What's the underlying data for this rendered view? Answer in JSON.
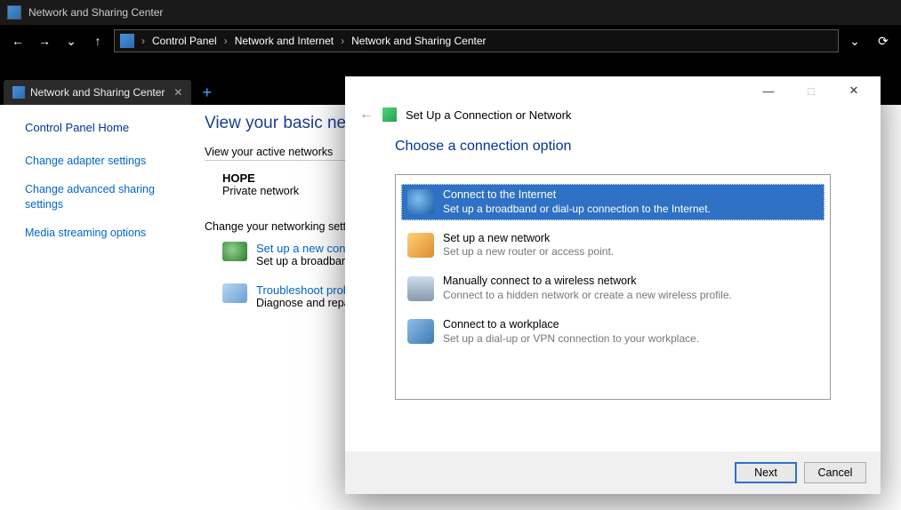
{
  "window": {
    "title": "Network and Sharing Center"
  },
  "breadcrumb": {
    "items": [
      "Control Panel",
      "Network and Internet",
      "Network and Sharing Center"
    ]
  },
  "tab": {
    "label": "Network and Sharing Center"
  },
  "sidebar": {
    "home": "Control Panel Home",
    "links": [
      "Change adapter settings",
      "Change advanced sharing settings",
      "Media streaming options"
    ]
  },
  "content": {
    "heading": "View your basic netwo",
    "section_active": "View your active networks",
    "network_name": "HOPE",
    "network_type": "Private network",
    "section_change": "Change your networking setti",
    "tasks": [
      {
        "title": "Set up a new conne",
        "desc": "Set up a broadband"
      },
      {
        "title": "Troubleshoot probl",
        "desc": "Diagnose and repai"
      }
    ]
  },
  "wizard": {
    "title": "Set Up a Connection or Network",
    "heading": "Choose a connection option",
    "options": [
      {
        "title": "Connect to the Internet",
        "desc": "Set up a broadband or dial-up connection to the Internet.",
        "selected": true,
        "icon": "internet"
      },
      {
        "title": "Set up a new network",
        "desc": "Set up a new router or access point.",
        "selected": false,
        "icon": "router"
      },
      {
        "title": "Manually connect to a wireless network",
        "desc": "Connect to a hidden network or create a new wireless profile.",
        "selected": false,
        "icon": "wifi"
      },
      {
        "title": "Connect to a workplace",
        "desc": "Set up a dial-up or VPN connection to your workplace.",
        "selected": false,
        "icon": "vpn"
      }
    ],
    "buttons": {
      "next": "Next",
      "cancel": "Cancel"
    }
  }
}
